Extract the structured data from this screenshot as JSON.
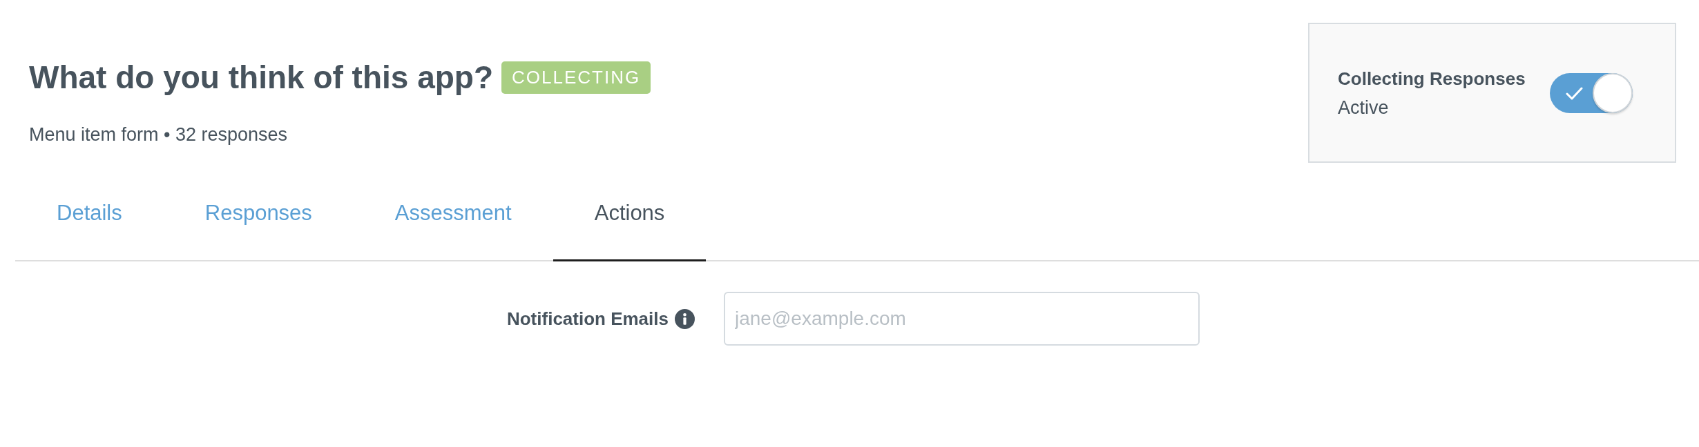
{
  "header": {
    "title": "What do you think of this app?",
    "status_badge": "COLLECTING",
    "subtitle": "Menu item form • 32 responses"
  },
  "collecting_card": {
    "label": "Collecting Responses",
    "status": "Active",
    "on": true
  },
  "tabs": [
    {
      "label": "Details",
      "selected": false
    },
    {
      "label": "Responses",
      "selected": false
    },
    {
      "label": "Assessment",
      "selected": false
    },
    {
      "label": "Actions",
      "selected": true
    }
  ],
  "notification_emails": {
    "label": "Notification Emails",
    "placeholder": "jane@example.com"
  }
}
